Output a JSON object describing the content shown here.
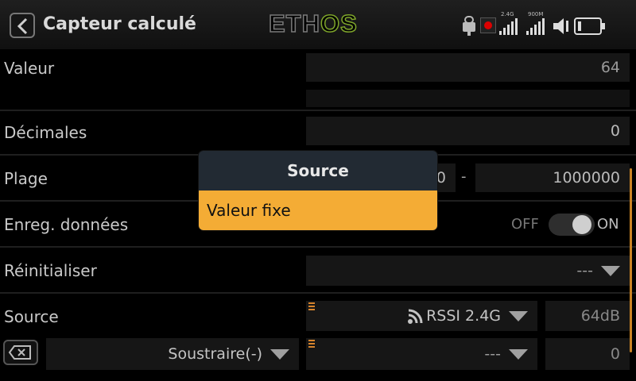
{
  "header": {
    "title": "Capteur calculé",
    "logo_left": "ETH",
    "logo_right": "OS",
    "status": {
      "rssi_24": "2.4G",
      "rssi_900": "900M"
    }
  },
  "rows": {
    "valeur": {
      "label": "Valeur",
      "value": "64"
    },
    "decimales": {
      "label": "Décimales",
      "value": "0"
    },
    "plage": {
      "label": "Plage",
      "min_partial": "00",
      "sep": "-",
      "max": "1000000"
    },
    "enreg": {
      "label": "Enreg. données",
      "off": "OFF",
      "on": "ON",
      "state": "on"
    },
    "reinit": {
      "label": "Réinitialiser",
      "value": "---"
    },
    "source": {
      "label": "Source",
      "sensor": "RSSI 2.4G",
      "reading": "64dB"
    },
    "source2": {
      "operation": "Soustraire(-)",
      "sensor": "---",
      "reading": "0"
    }
  },
  "dialog": {
    "title": "Source",
    "options": [
      "Valeur fixe"
    ],
    "selected": 0
  },
  "colors": {
    "accent": "#f4ac35",
    "dialog_bg": "#222a33",
    "logo_os": "#7fa62b"
  }
}
